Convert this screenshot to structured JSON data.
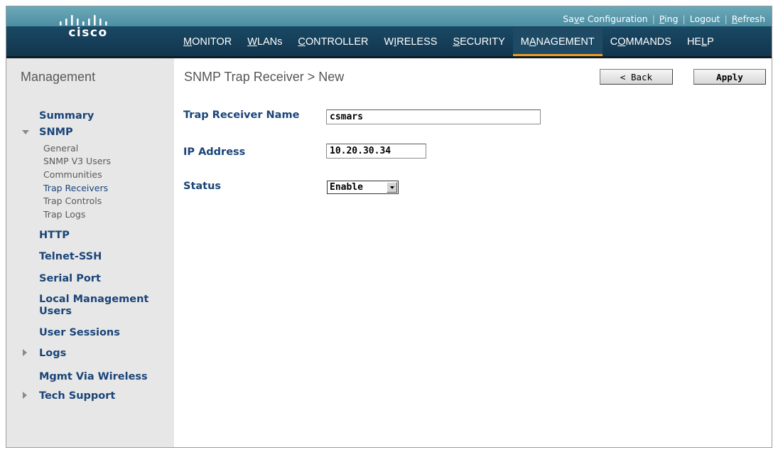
{
  "brand": {
    "logo_text": "cisco"
  },
  "top_links": [
    {
      "label": "Save Configuration",
      "underline_index": 2
    },
    {
      "label": "Ping",
      "underline_index": 0
    },
    {
      "label": "Logout",
      "underline_index": 2
    },
    {
      "label": "Refresh",
      "underline_index": 0
    }
  ],
  "nav": [
    {
      "label": "MONITOR",
      "underline_index": 0,
      "active": false
    },
    {
      "label": "WLANs",
      "underline_index": 0,
      "active": false
    },
    {
      "label": "CONTROLLER",
      "underline_index": 0,
      "active": false
    },
    {
      "label": "WIRELESS",
      "underline_index": 1,
      "active": false
    },
    {
      "label": "SECURITY",
      "underline_index": 0,
      "active": false
    },
    {
      "label": "MANAGEMENT",
      "underline_index": 1,
      "active": true
    },
    {
      "label": "COMMANDS",
      "underline_index": 1,
      "active": false
    },
    {
      "label": "HELP",
      "underline_index": 2,
      "active": false
    }
  ],
  "sidebar": {
    "title": "Management",
    "summary": "Summary",
    "snmp": {
      "label": "SNMP",
      "items": [
        "General",
        "SNMP V3 Users",
        "Communities",
        "Trap Receivers",
        "Trap Controls",
        "Trap Logs"
      ]
    },
    "http": "HTTP",
    "telnet_ssh": "Telnet-SSH",
    "serial_port": "Serial Port",
    "local_mgmt_users_line1": "Local Management",
    "local_mgmt_users_line2": "Users",
    "user_sessions": "User Sessions",
    "logs": "Logs",
    "mgmt_via_wireless": "Mgmt Via Wireless",
    "tech_support": "Tech Support"
  },
  "main": {
    "title": "SNMP Trap Receiver > New",
    "back_button": "< Back",
    "apply_button": "Apply",
    "trap_receiver_name_label": "Trap Receiver Name",
    "trap_receiver_name_value": "csmars",
    "ip_address_label": "IP Address",
    "ip_address_value": "10.20.30.34",
    "status_label": "Status",
    "status_value": "Enable"
  }
}
